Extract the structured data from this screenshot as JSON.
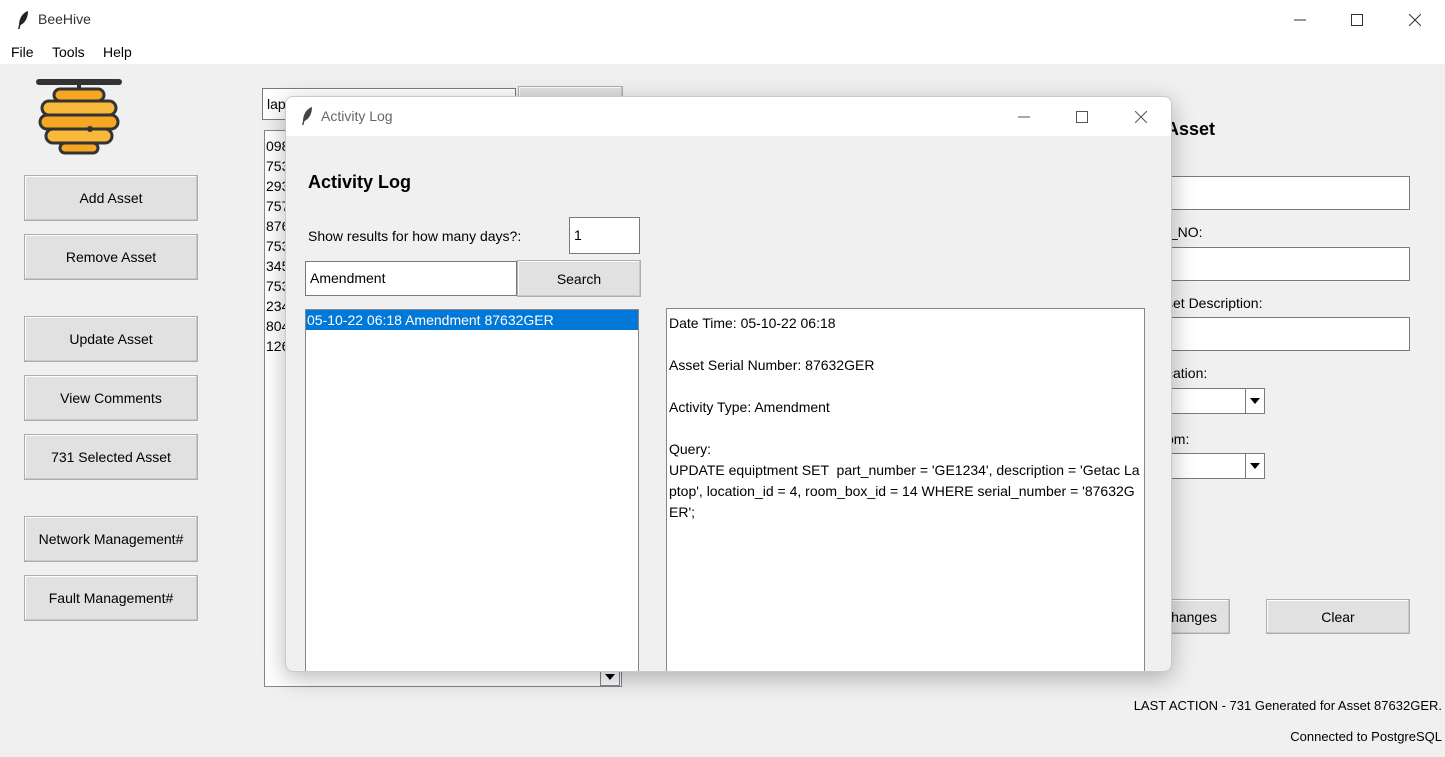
{
  "app": {
    "title": "BeeHive",
    "menu": [
      "File",
      "Tools",
      "Help"
    ]
  },
  "sidebar": {
    "buttons": {
      "add_asset": "Add Asset",
      "remove_asset": "Remove Asset",
      "update_asset": "Update Asset",
      "view_comments": "View Comments",
      "selected_asset_731": "731 Selected Asset",
      "network_management": "Network Management#",
      "fault_management": "Fault Management#"
    }
  },
  "main": {
    "search_value": "lap",
    "serial_list": [
      "098",
      "753",
      "293",
      "757",
      "876",
      "753",
      "345",
      "753",
      "234",
      "804",
      "126"
    ],
    "form": {
      "title": "Asset",
      "part_no_label": "t_NO:",
      "description_label": "set Description:",
      "location_label": "cation:",
      "room_label": "om:",
      "save_changes_label": "hanges",
      "clear_label": "Clear"
    }
  },
  "status": {
    "last_action": "LAST ACTION - 731 Generated for Asset 87632GER.",
    "connection": "Connected to PostgreSQL"
  },
  "dialog": {
    "window_title": "Activity Log",
    "heading": "Activity Log",
    "days_label": "Show results for how many days?:",
    "days_value": "1",
    "filter_value": "Amendment",
    "search_button": "Search",
    "results": [
      "05-10-22 06:18 Amendment 87632GER"
    ],
    "details": {
      "date_time": "Date Time: 05-10-22 06:18",
      "serial": "Asset Serial Number: 87632GER",
      "activity_type": "Activity Type: Amendment",
      "query_label": "Query:",
      "query_text": "UPDATE equiptment SET  part_number = 'GE1234', description = 'Getac Laptop', location_id = 4, room_box_id = 14 WHERE serial_number = '87632GER';"
    }
  },
  "colors": {
    "selection": "#0078d7",
    "background": "#f0f0f0",
    "button": "#e1e1e1",
    "logo_honey": "#f5a623",
    "logo_outline": "#333333"
  }
}
